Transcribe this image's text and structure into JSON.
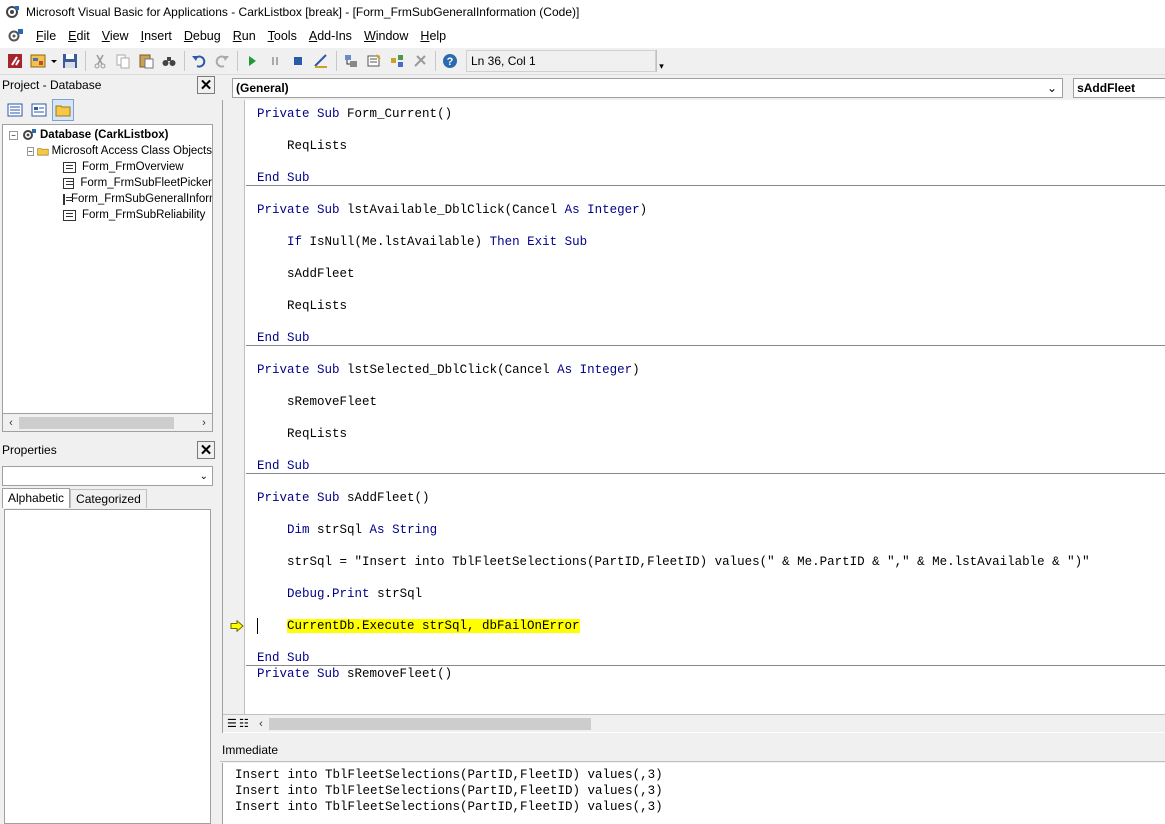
{
  "window": {
    "title": "Microsoft Visual Basic for Applications - CarkListbox [break] - [Form_FrmSubGeneralInformation (Code)]"
  },
  "menu": [
    {
      "label": "File",
      "ul": "F",
      "rest": "ile"
    },
    {
      "label": "Edit",
      "ul": "E",
      "rest": "dit"
    },
    {
      "label": "View",
      "ul": "V",
      "rest": "iew"
    },
    {
      "label": "Insert",
      "ul": "I",
      "rest": "nsert"
    },
    {
      "label": "Debug",
      "ul": "D",
      "rest": "ebug"
    },
    {
      "label": "Run",
      "ul": "R",
      "rest": "un"
    },
    {
      "label": "Tools",
      "ul": "T",
      "rest": "ools"
    },
    {
      "label": "Add-Ins",
      "ul": "A",
      "rest": "dd-Ins"
    },
    {
      "label": "Window",
      "ul": "W",
      "rest": "indow"
    },
    {
      "label": "Help",
      "ul": "H",
      "rest": "elp"
    }
  ],
  "toolbar": {
    "position": "Ln 36, Col 1"
  },
  "project": {
    "title": "Project - Database",
    "root": "Database (CarkListbox)",
    "folder": "Microsoft Access Class Objects",
    "items": [
      "Form_FrmOverview",
      "Form_FrmSubFleetPicker",
      "Form_FrmSubGeneralInformation",
      "Form_FrmSubReliability"
    ]
  },
  "properties": {
    "title": "Properties",
    "tabs": [
      "Alphabetic",
      "Categorized"
    ]
  },
  "code": {
    "object_combo": "(General)",
    "proc_combo": "sAddFleet",
    "lines": [
      {
        "text": "Private Sub Form_Current()"
      },
      {
        "text": "    ReqLists"
      },
      {
        "text": "End Sub"
      },
      {
        "text": "Private Sub lstAvailable_DblClick(Cancel As Integer)"
      },
      {
        "text": "    If IsNull(Me.lstAvailable) Then Exit Sub"
      },
      {
        "text": "    sAddFleet"
      },
      {
        "text": "    ReqLists"
      },
      {
        "text": "End Sub"
      },
      {
        "text": "Private Sub lstSelected_DblClick(Cancel As Integer)"
      },
      {
        "text": "    sRemoveFleet"
      },
      {
        "text": "    ReqLists"
      },
      {
        "text": "End Sub"
      },
      {
        "text": "Private Sub sAddFleet()"
      },
      {
        "text": "    Dim strSql As String"
      },
      {
        "text": "    strSql = \"Insert into TblFleetSelections(PartID,FleetID) values(\" & Me.PartID & \",\" & Me.lstAvailable & \")\""
      },
      {
        "text": "    Debug.Print strSql"
      },
      {
        "text": "    CurrentDb.Execute strSql, dbFailOnError"
      },
      {
        "text": "End Sub"
      },
      {
        "text": "Private Sub sRemoveFleet()"
      }
    ]
  },
  "immediate": {
    "title": "Immediate",
    "lines": [
      "Insert into TblFleetSelections(PartID,FleetID) values(,3)",
      "Insert into TblFleetSelections(PartID,FleetID) values(,3)",
      "Insert into TblFleetSelections(PartID,FleetID) values(,3)"
    ]
  },
  "colors": {
    "keyword": "#00008b",
    "highlight": "#ffff00"
  }
}
